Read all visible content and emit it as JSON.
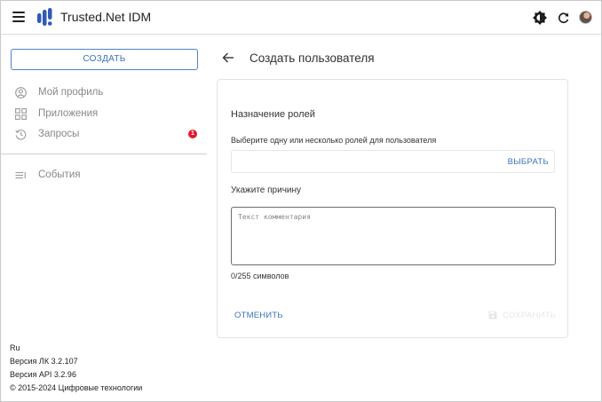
{
  "header": {
    "app_title": "Trusted.Net IDM",
    "icons": [
      "menu-icon",
      "brightness-icon",
      "refresh-icon",
      "avatar"
    ]
  },
  "sidebar": {
    "create_label": "СОЗДАТЬ",
    "items": [
      {
        "label": "Мой профиль",
        "icon": "user-circle-icon"
      },
      {
        "label": "Приложения",
        "icon": "apps-grid-icon"
      },
      {
        "label": "Запросы",
        "icon": "history-icon",
        "badge": "1"
      },
      {
        "label": "События",
        "icon": "list-icon"
      }
    ],
    "footer": {
      "language": "Ru",
      "version_lk": "Версия ЛК 3.2.107",
      "version_api": "Версия API 3.2.96",
      "copyright": "© 2015-2024 Цифровые технологии"
    }
  },
  "main": {
    "page_title": "Создать пользователя",
    "form": {
      "section_title": "Назначение ролей",
      "roles_label": "Выберите одну или несколько ролей для пользователя",
      "roles_button": "ВЫБРАТЬ",
      "reason_label": "Укажите причину",
      "comment_placeholder": "Текст комментария",
      "comment_value": "",
      "counter": "0/255 символов",
      "cancel_label": "ОТМЕНИТЬ",
      "save_label": "СОХРАНИТЬ"
    }
  },
  "colors": {
    "accent": "#3a73b8",
    "badge": "#e5192c",
    "logo": "#2f5bb7"
  }
}
